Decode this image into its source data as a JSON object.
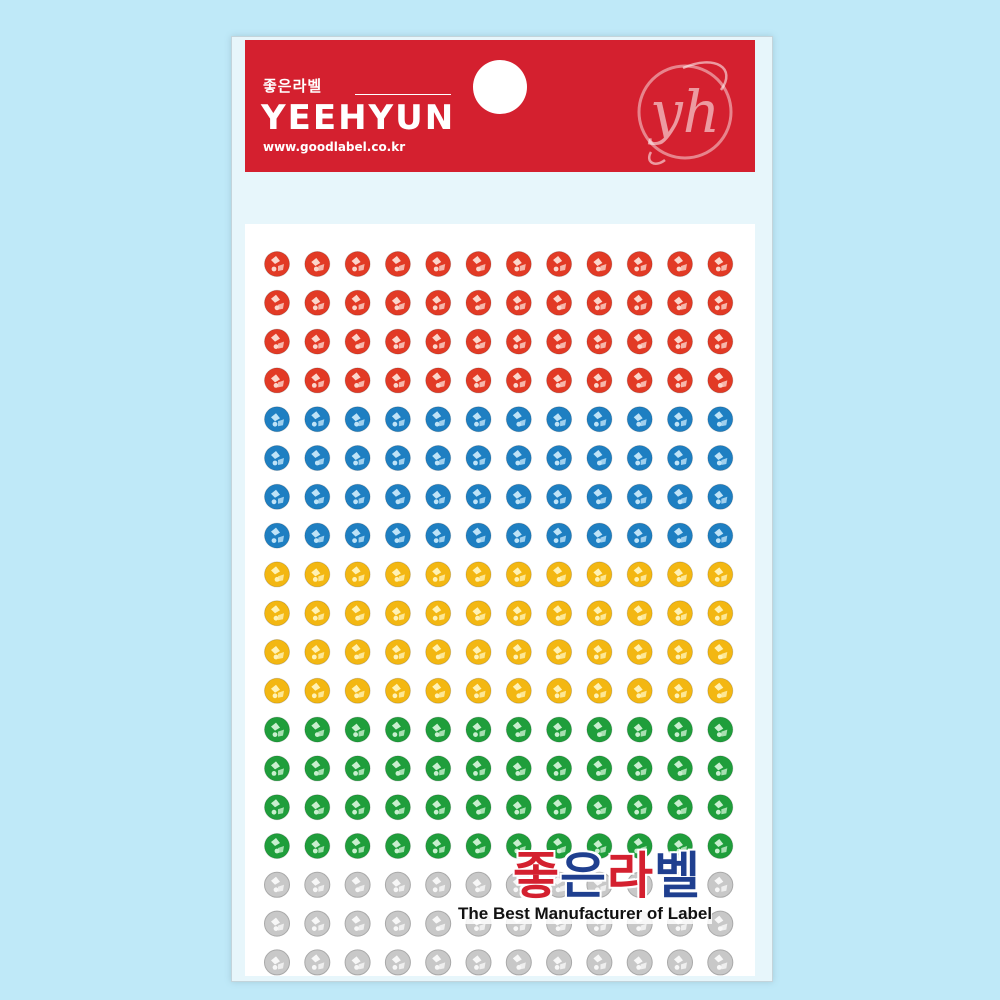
{
  "header": {
    "korean_name": "좋은라벨",
    "brand": "YEEHYUN",
    "url": "www.goodlabel.co.kr",
    "logo_letters": "yh",
    "background_color": "#d4202f"
  },
  "product": {
    "sticker_columns": 12,
    "sticker_rows": [
      {
        "color": "red",
        "count": 4,
        "base": "#e23a25",
        "highlight": "#fbd6cc"
      },
      {
        "color": "blue",
        "count": 4,
        "base": "#1e7fc2",
        "highlight": "#bfe3f7"
      },
      {
        "color": "yellow",
        "count": 4,
        "base": "#f3b712",
        "highlight": "#fff2b5"
      },
      {
        "color": "green",
        "count": 4,
        "base": "#1f9e3b",
        "highlight": "#c9efcf"
      },
      {
        "color": "clear",
        "count": 3,
        "base": "#c8c8c8",
        "highlight": "#f7f7f7"
      }
    ]
  },
  "bottom_brand": {
    "chars": [
      {
        "text": "좋",
        "color": "#d4202f"
      },
      {
        "text": "은",
        "color": "#1f3f8f"
      },
      {
        "text": "라",
        "color": "#d4202f"
      },
      {
        "text": "벨",
        "color": "#1f3f8f"
      }
    ],
    "tagline": "The Best Manufacturer of Label"
  }
}
